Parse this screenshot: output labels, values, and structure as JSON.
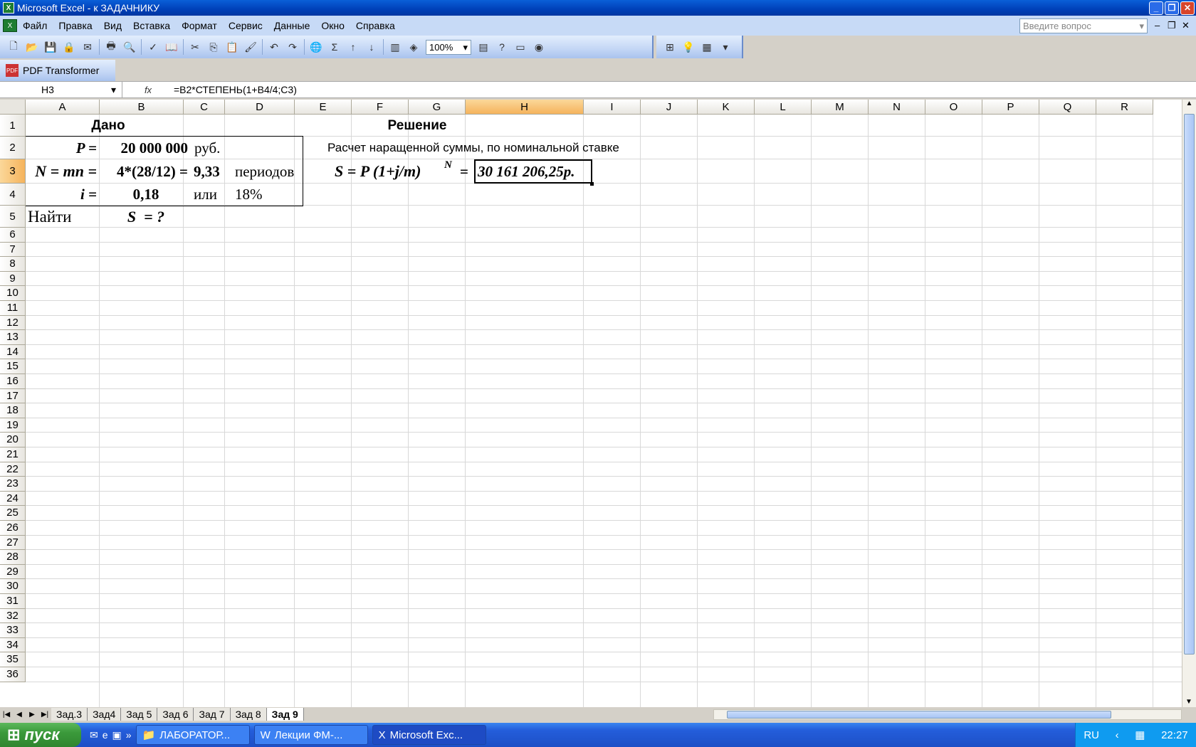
{
  "window": {
    "title": "Microsoft Excel - к ЗАДАЧНИКУ"
  },
  "menu": [
    "Файл",
    "Правка",
    "Вид",
    "Вставка",
    "Формат",
    "Сервис",
    "Данные",
    "Окно",
    "Справка"
  ],
  "ask_placeholder": "Введите вопрос",
  "toolbar": {
    "zoom": "100%"
  },
  "pdf_toolbar": {
    "label": "PDF Transformer"
  },
  "formula_bar": {
    "name_box": "H3",
    "fx": "fx",
    "formula": "=B2*СТЕПЕНЬ(1+B4/4;C3)"
  },
  "columns": [
    "A",
    "B",
    "C",
    "D",
    "E",
    "F",
    "G",
    "H",
    "I",
    "J",
    "K",
    "L",
    "M",
    "N",
    "O",
    "P",
    "Q",
    "R"
  ],
  "selected_column": "H",
  "selected_row": 3,
  "cells": {
    "A1_B1": "Дано",
    "A2": "P =",
    "B2": "20 000 000",
    "C2": "руб.",
    "A3": "N = mn =",
    "B3": "4*(28/12) =",
    "C3": "9,33",
    "D3": "периодов",
    "A4": "i =",
    "B4": "0,18",
    "C4": "или",
    "D4": "18%",
    "A5": "Найти",
    "B5": "S  = ?",
    "F1": "Решение",
    "E2": "Расчет наращенной суммы, по номинальной ставке",
    "E3": "S = P (1+j/m)",
    "E3_sup": "N",
    "G3": "=",
    "H3": "30 161 206,25р."
  },
  "sheet_tabs": [
    "Зад.3",
    "Зад4",
    "Зад 5",
    "Зад 6",
    "Зад 7",
    "Зад 8",
    "Зад 9"
  ],
  "active_sheet": "Зад 9",
  "taskbar": {
    "start": "пуск",
    "tasks": [
      "ЛАБОРАТОР...",
      "Лекции ФМ-...",
      "Microsoft Exc..."
    ],
    "lang": "RU",
    "clock": "22:27"
  }
}
